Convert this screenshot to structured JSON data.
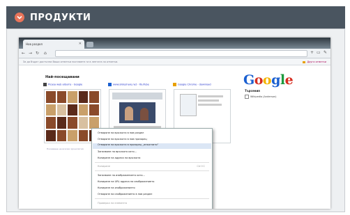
{
  "header": {
    "title": "ПРОДУКТИ",
    "icon": "chevron-down-icon"
  },
  "browser": {
    "tab_title": "Нов раздел",
    "bookmarks_hint": "За да бъдат достъпни Ваши отметки поставете ги в лентата за отметки.",
    "other_bookmarks": "Други отметки",
    "most_visited_title": "Най-посещавани",
    "google_logo": [
      "G",
      "o",
      "o",
      "g",
      "l",
      "e"
    ],
    "google_logo_colors": [
      "#1a5fd0",
      "#d62d20",
      "#f4b400",
      "#1a5fd0",
      "#1c9a3e",
      "#d62d20"
    ],
    "thumbnails": [
      {
        "title": "Picasa web albums - Google"
      },
      {
        "title": "www.slideshare.net - YouTube"
      },
      {
        "title": "Google Chrome - download"
      }
    ],
    "searches": {
      "title": "Търсения",
      "item": "Wikipedia (Anderson)"
    },
    "footer_link": "Показване на всички хронология"
  },
  "context_menu": {
    "items": [
      {
        "label": "Отваряне на връзката в нов раздел",
        "state": "normal"
      },
      {
        "label": "Отваряне на връзката в нов прозорец",
        "state": "normal"
      },
      {
        "label": "Отваряне на връзката в прозорец „инкогнито“",
        "state": "highlighted"
      },
      {
        "label": "Запазване на връзката като...",
        "state": "normal"
      },
      {
        "label": "Копиране на адреса на връзката",
        "state": "normal"
      },
      {
        "label": "Копиране",
        "state": "disabled",
        "shortcut": "Ctrl+C"
      },
      {
        "label": "Запазване на изображението като...",
        "state": "normal"
      },
      {
        "label": "Копиране на URL адреса на изображението",
        "state": "normal"
      },
      {
        "label": "Копиране на изображението",
        "state": "normal"
      },
      {
        "label": "Отваряне на изображението в нов раздел",
        "state": "normal"
      },
      {
        "label": "Проверка на елемента",
        "state": "disabled"
      }
    ]
  }
}
